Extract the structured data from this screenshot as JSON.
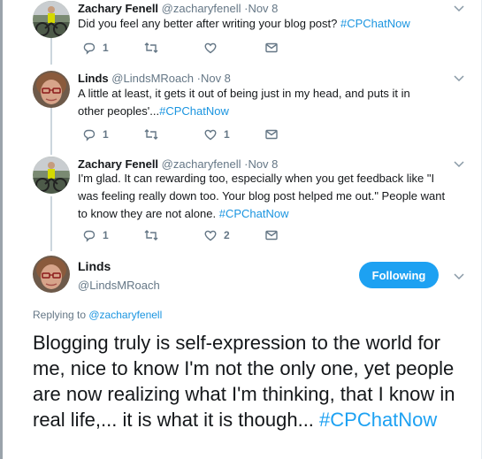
{
  "tweets": [
    {
      "name": "Zachary Fenell",
      "handle": "@zacharyfenell",
      "dot": "·",
      "date": "Nov 8",
      "text": "Did you feel any better after writing your blog post? ",
      "hashtag": "#CPChatNow",
      "reply_count": "1",
      "retweet_count": "",
      "like_count": "",
      "avatar": "person-on-bicycle-avatar"
    },
    {
      "name": "Linds",
      "handle": "@LindsMRoach",
      "dot": "·",
      "date": "Nov 8",
      "text": "A little at least, it gets it out of being just in my head, and puts it in other peoples'...",
      "hashtag": "#CPChatNow",
      "reply_count": "1",
      "retweet_count": "",
      "like_count": "1",
      "avatar": "woman-with-glasses-avatar"
    },
    {
      "name": "Zachary Fenell",
      "handle": "@zacharyfenell",
      "dot": "·",
      "date": "Nov 8",
      "text": "I'm glad. It can rewarding too, especially when you get feedback like \"I was feeling really down too. Your blog post helped me out.\" People want to know they are not alone. ",
      "hashtag": "#CPChatNow",
      "reply_count": "1",
      "retweet_count": "",
      "like_count": "2",
      "avatar": "person-on-bicycle-avatar"
    }
  ],
  "focus": {
    "name": "Linds",
    "handle": "@LindsMRoach",
    "follow_label": "Following",
    "replying_prefix": "Replying to ",
    "replying_mention": "@zacharyfenell",
    "text": "Blogging truly is self-expression to the world for me, nice to know I'm not the only one, yet people are now realizing what I'm thinking, that I know in real life,... it is what it is though... ",
    "hashtag": "#CPChatNow"
  },
  "icons": [
    "reply-icon",
    "retweet-icon",
    "like-icon",
    "direct-message-icon",
    "chevron-down-icon"
  ],
  "colors": {
    "link": "#1b95e0",
    "follow_button": "#1da1f2",
    "secondary_text": "#657786",
    "thread_line": "#ccd6dd"
  }
}
